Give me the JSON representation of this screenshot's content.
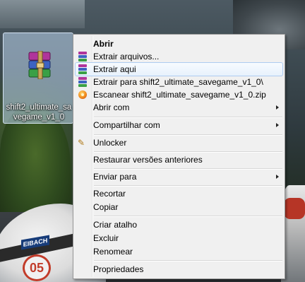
{
  "desktop": {
    "icon_label": "shift2_ultimate_savegame_v1_0",
    "wallpaper_car_number": "05",
    "wallpaper_car_badge": "EIBACH"
  },
  "context_menu": {
    "items": [
      {
        "label": "Abrir",
        "bold": true
      },
      {
        "label": "Extrair arquivos...",
        "icon": "winrar-icon"
      },
      {
        "label": "Extrair aqui",
        "icon": "winrar-icon",
        "highlighted": true
      },
      {
        "label": "Extrair para shift2_ultimate_savegame_v1_0\\",
        "icon": "winrar-icon"
      },
      {
        "label": "Escanear shift2_ultimate_savegame_v1_0.zip",
        "icon": "antivirus-scan-icon"
      },
      {
        "label": "Abrir com",
        "submenu": true
      },
      {
        "label": "Compartilhar com",
        "submenu": true
      },
      {
        "label": "Unlocker",
        "icon": "unlocker-icon"
      },
      {
        "label": "Restaurar versões anteriores"
      },
      {
        "label": "Enviar para",
        "submenu": true
      },
      {
        "label": "Recortar"
      },
      {
        "label": "Copiar"
      },
      {
        "label": "Criar atalho"
      },
      {
        "label": "Excluir"
      },
      {
        "label": "Renomear"
      },
      {
        "label": "Propriedades"
      }
    ]
  },
  "colors": {
    "menu_bg": "#f0f0f0",
    "highlight_border": "#aeccf1",
    "selection_bg": "#bed7f0"
  }
}
